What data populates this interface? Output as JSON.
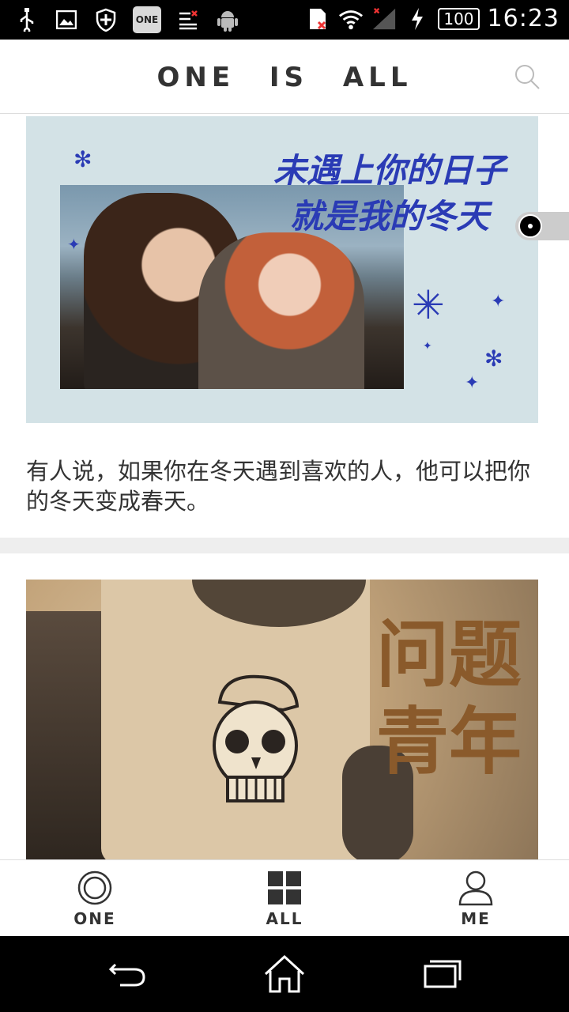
{
  "status_bar": {
    "one_badge": "ONE",
    "battery": "100",
    "time": "16:23",
    "icons": [
      "usb-icon",
      "image-icon",
      "shield-icon",
      "one-app-icon",
      "list-icon",
      "android-icon",
      "sim-icon",
      "wifi-icon",
      "signal-icon",
      "charging-icon",
      "battery-icon"
    ]
  },
  "header": {
    "brand": "ONE IS ALL",
    "search_icon": "search-icon"
  },
  "feed": {
    "cards": [
      {
        "image_caption_line1": "未遇上你的日子",
        "image_caption_line2": "就是我的冬天",
        "quote": "有人说，如果你在冬天遇到喜欢的人，他可以把你的冬天变成春天。"
      },
      {
        "image_caption_line1": "问题",
        "image_caption_line2": "青年"
      }
    ]
  },
  "tab_bar": {
    "tabs": [
      {
        "label": "ONE",
        "icon": "ring-icon"
      },
      {
        "label": "ALL",
        "icon": "grid-icon"
      },
      {
        "label": "ME",
        "icon": "person-icon"
      }
    ]
  },
  "nav_bar": {
    "icons": [
      "back-icon",
      "home-icon",
      "recent-apps-icon"
    ]
  },
  "colors": {
    "accent_blue": "#2a3bb5",
    "card1_bg": "#d3e2e6",
    "card2_ink": "#8a5a2b"
  }
}
